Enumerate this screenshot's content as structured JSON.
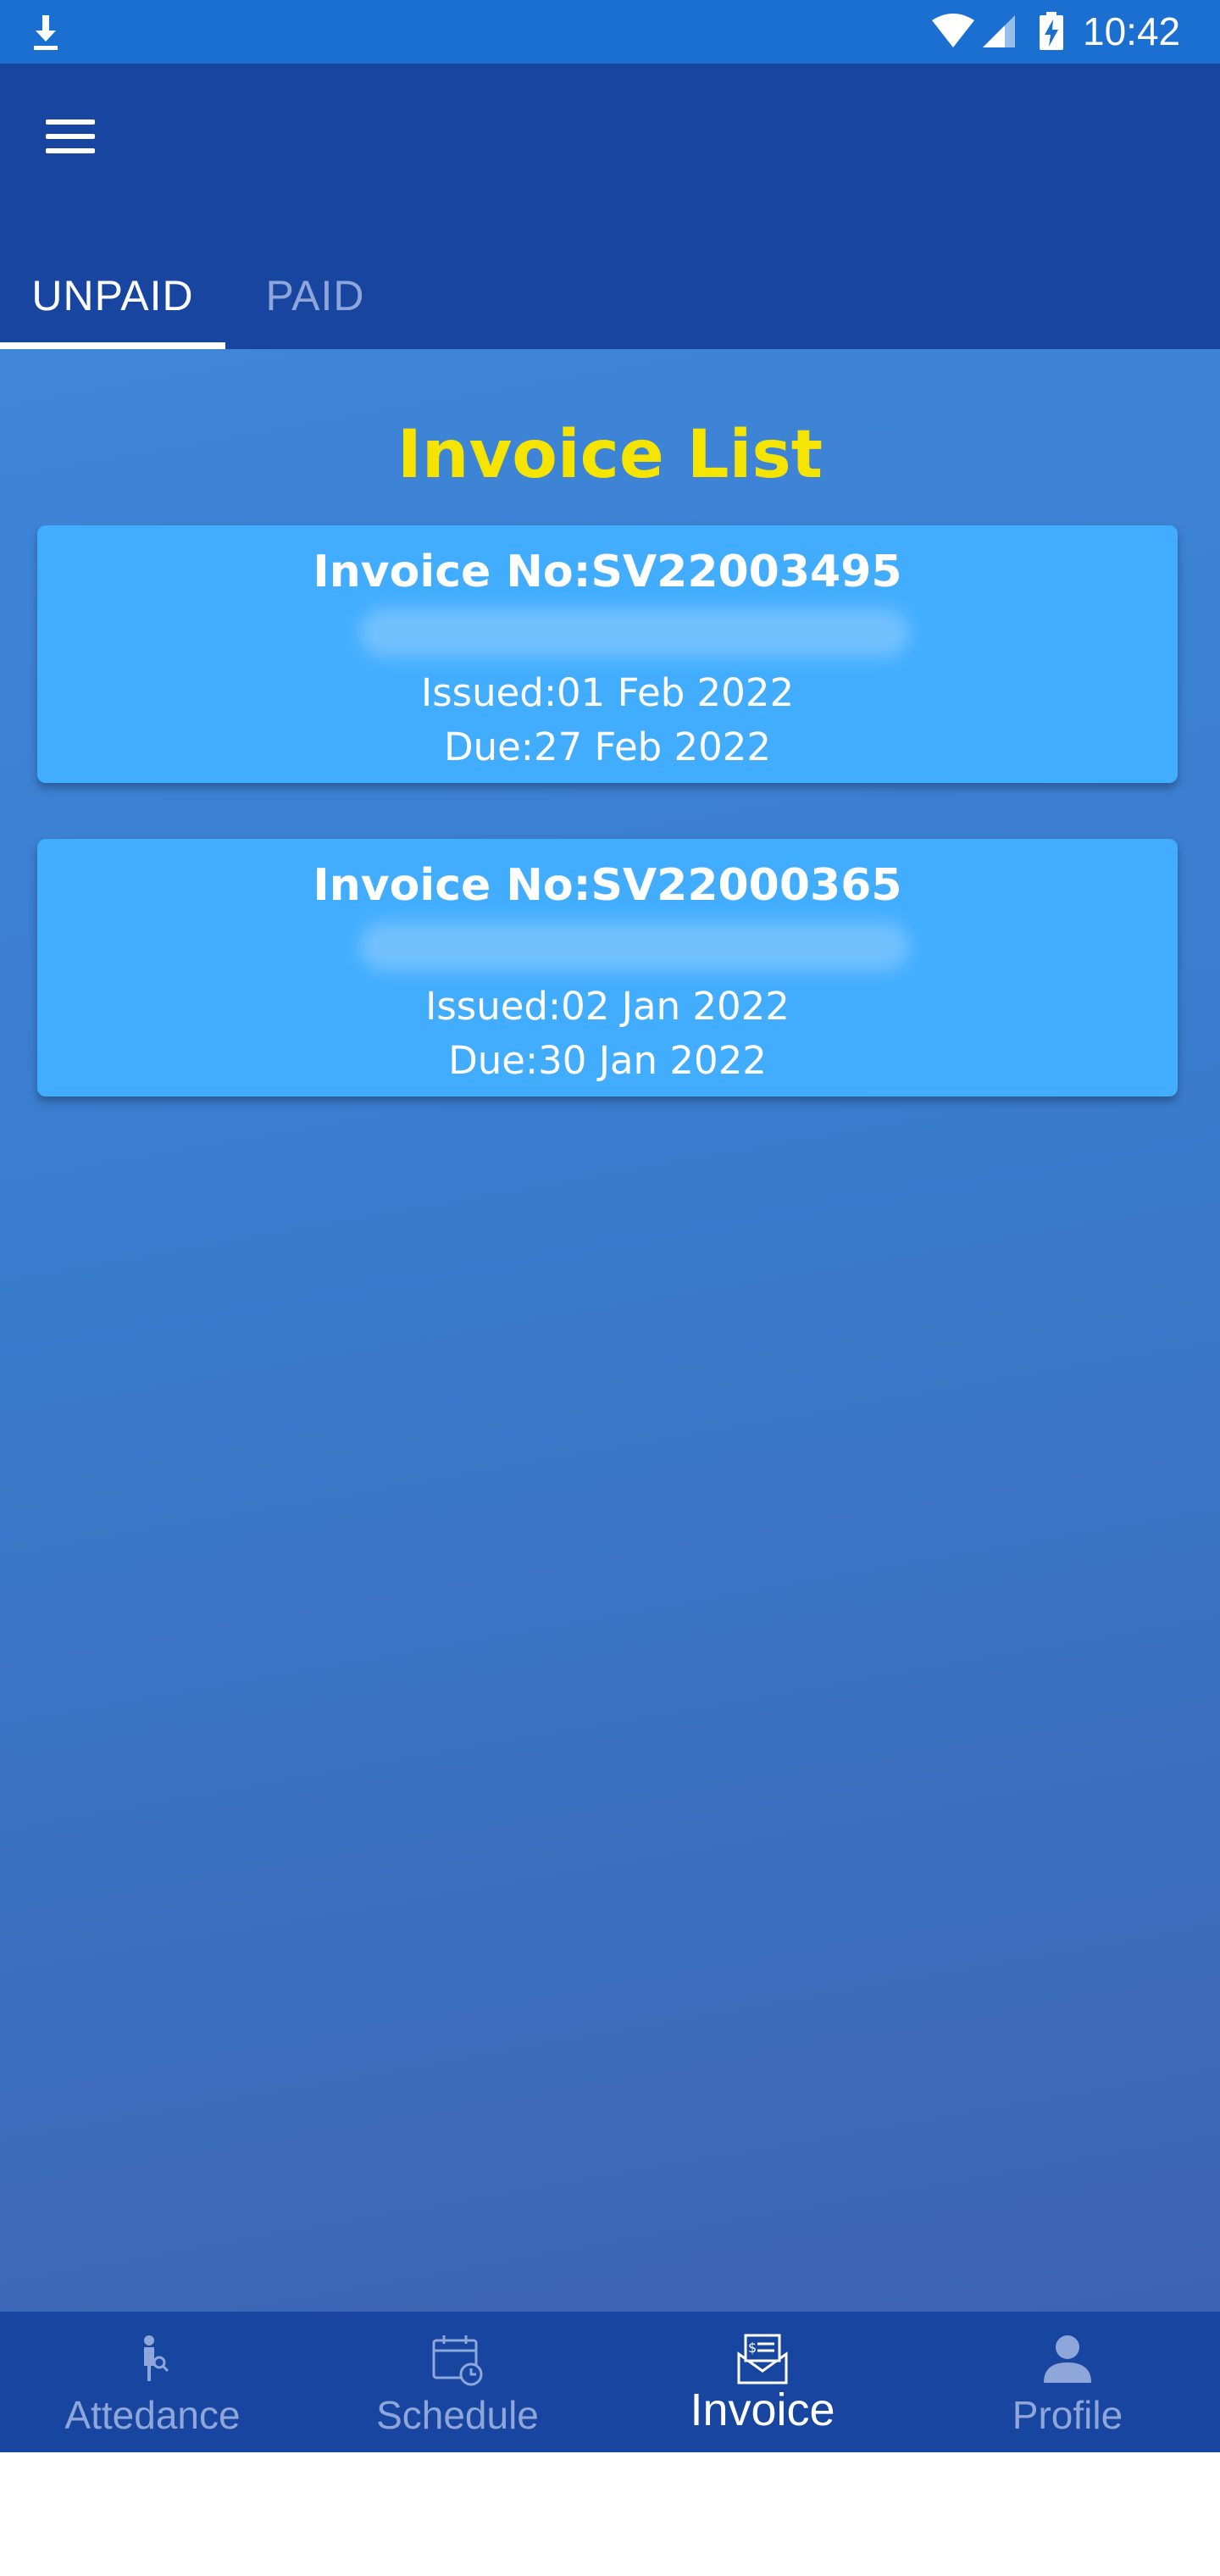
{
  "status_bar": {
    "time": "10:42"
  },
  "tabs": [
    {
      "label": "UNPAID",
      "active": true
    },
    {
      "label": "PAID",
      "active": false
    }
  ],
  "invoice_list": {
    "title": "Invoice List",
    "title_color": "#f5e400",
    "items": [
      {
        "invoice_no": "Invoice No:SV22003495",
        "issued": "Issued:01 Feb 2022",
        "due": "Due:27 Feb 2022"
      },
      {
        "invoice_no": "Invoice No:SV22000365",
        "issued": "Issued:02 Jan 2022",
        "due": "Due:30 Jan 2022"
      }
    ]
  },
  "bottom_nav": [
    {
      "label": "Attedance",
      "icon": "attendance-icon",
      "active": false
    },
    {
      "label": "Schedule",
      "icon": "calendar-clock-icon",
      "active": false
    },
    {
      "label": "Invoice",
      "icon": "invoice-icon",
      "active": true
    },
    {
      "label": "Profile",
      "icon": "profile-icon",
      "active": false
    }
  ],
  "colors": {
    "status_bar": "#1a6fd0",
    "app_bar": "#17459f",
    "card": "#42adff",
    "inactive": "#8ea6d9"
  }
}
